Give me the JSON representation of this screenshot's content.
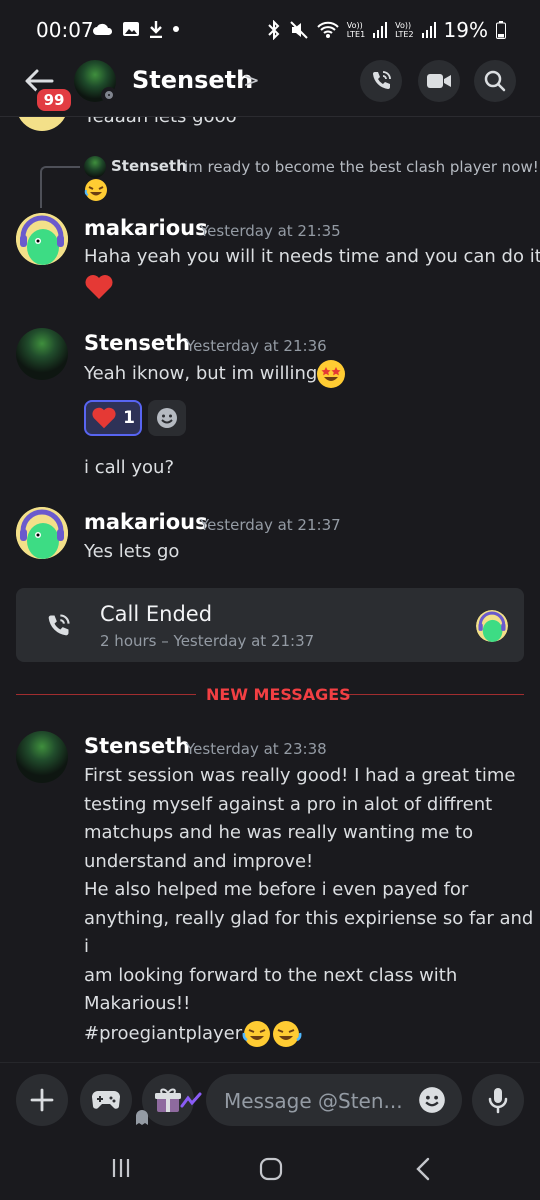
{
  "status_bar": {
    "time": "00:07",
    "network_1": "Vo))\nLTE1",
    "network_2": "Vo))\nLTE2",
    "battery": "19%"
  },
  "header": {
    "badge_count": "99",
    "name": "Stenseth",
    "chevron": ">"
  },
  "messages": {
    "partial_text": "Yeaaah lets gooo",
    "reply_author": "Stenseth",
    "reply_text": "im ready to become the best clash player now!",
    "m1": {
      "author": "makarious",
      "time": "Yesterday at 21:35",
      "text": "Haha yeah you will it needs time and you can do it"
    },
    "m2": {
      "author": "Stenseth",
      "time": "Yesterday at 21:36",
      "text": "Yeah iknow, but im willing",
      "reaction_count": "1",
      "text2": "i call you?"
    },
    "m3": {
      "author": "makarious",
      "time": "Yesterday at 21:37",
      "text": "Yes lets go"
    },
    "call": {
      "title": "Call Ended",
      "subtitle": "2 hours – Yesterday at 21:37"
    },
    "new_messages_label": "NEW MESSAGES",
    "m4": {
      "author": "Stenseth",
      "time": "Yesterday at 23:38",
      "lines": [
        "First session was really good! I had a great time",
        "testing myself against a pro in alot of diffrent",
        "matchups and he was really wanting me to",
        "understand and improve!",
        "He also helped me before i even payed for",
        "anything, really glad for this expiriense so far and i",
        "am looking forward to the next class with",
        "Makarious!!",
        "#proegiantplayer"
      ]
    }
  },
  "composer": {
    "placeholder": "Message @Sten..."
  },
  "colors": {
    "accent": "#5865f2",
    "danger": "#f23f43",
    "background": "#1a1a1e",
    "surface": "#2b2d31"
  },
  "icons": [
    "back-arrow-icon",
    "call-icon",
    "video-icon",
    "search-icon",
    "plus-icon",
    "gamepad-icon",
    "gift-icon",
    "emoji-icon",
    "microphone-icon",
    "phone-call-icon",
    "heart-icon"
  ]
}
